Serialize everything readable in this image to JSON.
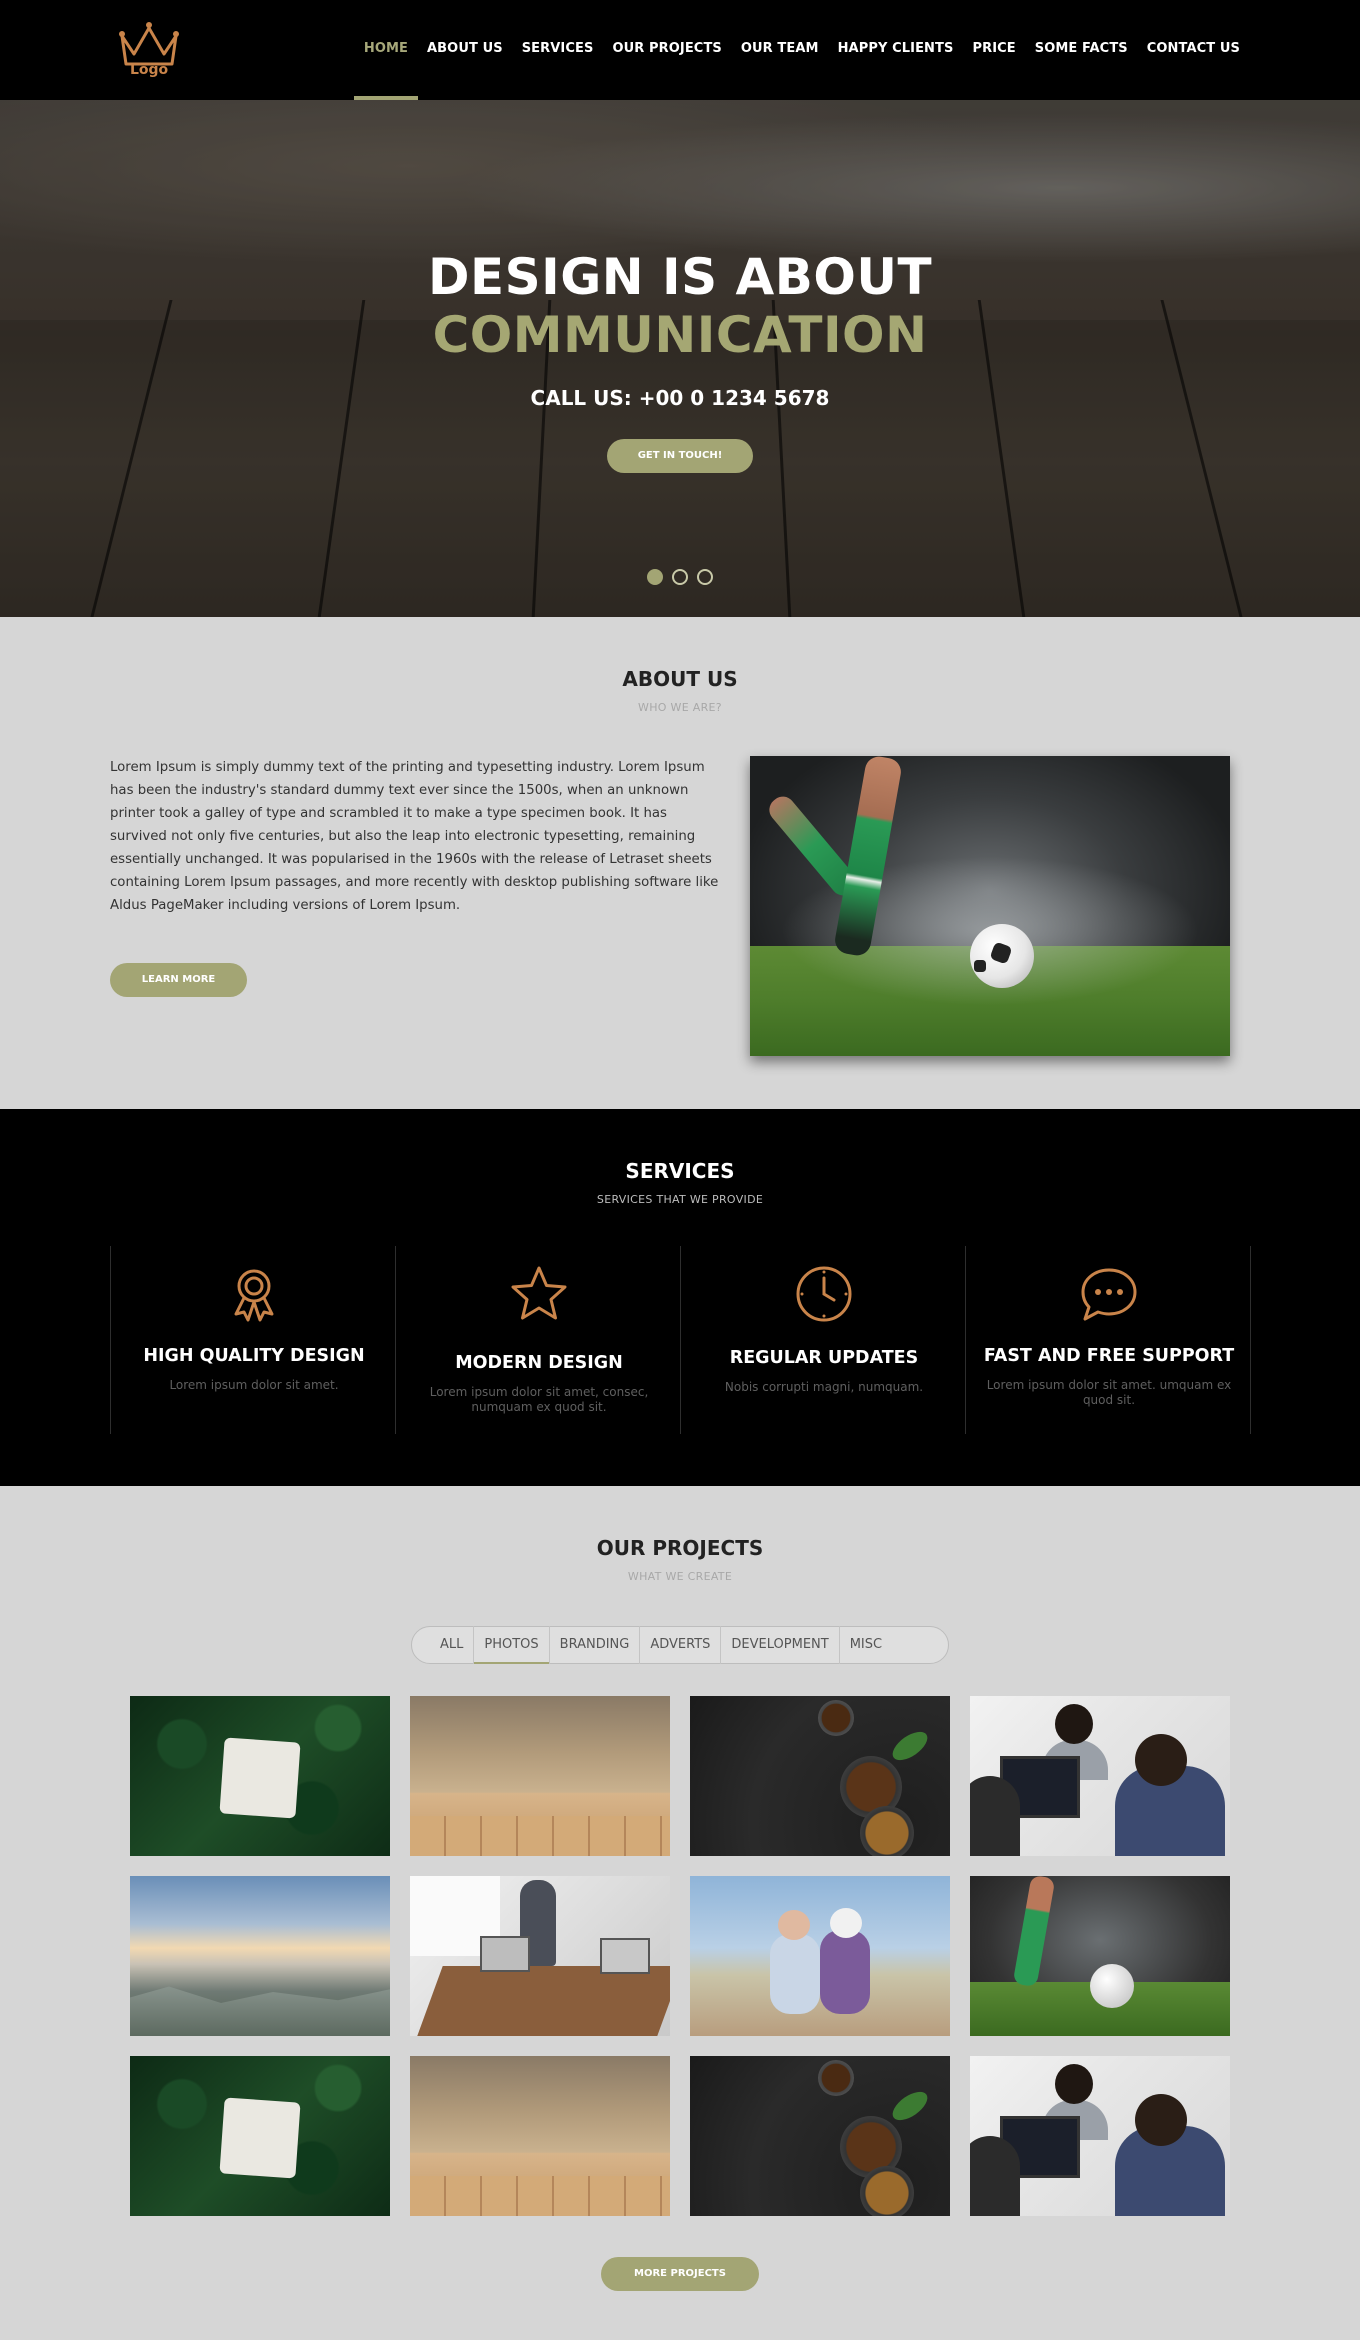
{
  "logo": {
    "text": "Logo",
    "icon": "crown-icon"
  },
  "nav": {
    "items": [
      {
        "label": "HOME",
        "active": true
      },
      {
        "label": "ABOUT US"
      },
      {
        "label": "SERVICES"
      },
      {
        "label": "OUR PROJECTS"
      },
      {
        "label": "OUR TEAM"
      },
      {
        "label": "HAPPY CLIENTS"
      },
      {
        "label": "PRICE"
      },
      {
        "label": "SOME FACTS"
      },
      {
        "label": "CONTACT US"
      }
    ]
  },
  "hero": {
    "title_line1": "DESIGN IS ABOUT",
    "title_line2": "COMMUNICATION",
    "call": "CALL US: +00 0 1234 5678",
    "button": "GET IN TOUCH!",
    "slides": 3,
    "active_slide": 1
  },
  "about": {
    "title": "ABOUT US",
    "subtitle": "WHO WE ARE?",
    "text": "Lorem Ipsum is simply dummy text of the printing and typesetting industry. Lorem Ipsum has been the industry's standard dummy text ever since the 1500s, when an unknown printer took a galley of type and scrambled it to make a type specimen book. It has survived not only five centuries, but also the leap into electronic typesetting, remaining essentially unchanged. It was popularised in the 1960s with the release of Letraset sheets containing Lorem Ipsum passages, and more recently with desktop publishing software like Aldus PageMaker including versions of Lorem Ipsum.",
    "button": "LEARN MORE"
  },
  "services": {
    "title": "SERVICES",
    "subtitle": "SERVICES THAT WE PROVIDE",
    "items": [
      {
        "icon": "award-icon",
        "title": "HIGH QUALITY DESIGN",
        "desc": "Lorem ipsum dolor sit amet."
      },
      {
        "icon": "star-icon",
        "title": "MODERN DESIGN",
        "desc": "Lorem ipsum dolor sit amet, consec, numquam ex quod sit."
      },
      {
        "icon": "clock-icon",
        "title": "REGULAR UPDATES",
        "desc": "Nobis corrupti magni, numquam."
      },
      {
        "icon": "chat-icon",
        "title": "FAST AND FREE SUPPORT",
        "desc": "Lorem ipsum dolor sit amet. umquam ex quod sit."
      }
    ]
  },
  "projects": {
    "title": "OUR PROJECTS",
    "subtitle": "WHAT WE CREATE",
    "filters": [
      {
        "label": "ALL"
      },
      {
        "label": "PHOTOS",
        "active": true
      },
      {
        "label": "BRANDING"
      },
      {
        "label": "ADVERTS"
      },
      {
        "label": "DEVELOPMENT"
      },
      {
        "label": "MISC"
      }
    ],
    "button": "MORE PROJECTS"
  },
  "colors": {
    "accent": "#a3a574",
    "icon": "#c9844a",
    "nav_bg": "#000000",
    "services_bg": "#000000",
    "page_bg": "#d6d6d6"
  }
}
